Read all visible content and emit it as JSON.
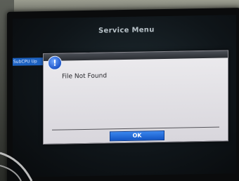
{
  "screen": {
    "title": "Service Menu",
    "side_tab_label": "SubCPU Up"
  },
  "dialog": {
    "icon": "info-icon",
    "icon_glyph": "!",
    "message": "File Not Found",
    "ok_label": "OK"
  },
  "colors": {
    "dialog_body": "#e2e1e5",
    "ok_button": "#1d63d6",
    "side_tab": "#1e63c2",
    "screen_bg": "#0f1519"
  }
}
